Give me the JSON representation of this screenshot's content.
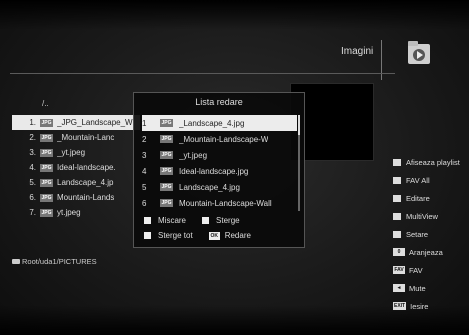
{
  "header": {
    "title": "Imagini"
  },
  "filelist": {
    "parent": "/..",
    "items": [
      {
        "num": "1.",
        "name": "_JPG_Landscape_W"
      },
      {
        "num": "2.",
        "name": "_Mountain-Lanc"
      },
      {
        "num": "3.",
        "name": "_yt.jpeg"
      },
      {
        "num": "4.",
        "name": "Ideal-landscape."
      },
      {
        "num": "5.",
        "name": "Landscape_4.jp"
      },
      {
        "num": "6.",
        "name": "Mountain-Lands"
      },
      {
        "num": "7.",
        "name": "yt.jpeg"
      }
    ],
    "badge": "JPG"
  },
  "path": "Root/uda1/PICTURES",
  "playlist": {
    "title": "Lista redare",
    "items": [
      {
        "num": "1",
        "name": "_Landscape_4.jpg"
      },
      {
        "num": "2",
        "name": "_Mountain-Landscape-W"
      },
      {
        "num": "3",
        "name": "_yt.jpeg"
      },
      {
        "num": "4",
        "name": "Ideal-landscape.jpg"
      },
      {
        "num": "5",
        "name": "Landscape_4.jpg"
      },
      {
        "num": "6",
        "name": "Mountain-Landscape-Wall"
      }
    ],
    "badge": "JPG",
    "actions": {
      "move": "Miscare",
      "delete": "Sterge",
      "delete_all": "Sterge tot",
      "ok_badge": "OK",
      "play": "Redare"
    }
  },
  "sidebar": {
    "items": [
      {
        "label": "Afiseaza playlist"
      },
      {
        "label": "FAV All"
      },
      {
        "label": "Editare"
      },
      {
        "label": "MultiView"
      },
      {
        "label": "Setare"
      },
      {
        "badge": "0",
        "label": "Aranjeaza"
      },
      {
        "badge": "FAV",
        "label": "FAV"
      },
      {
        "badge": "◄",
        "label": "Mute"
      },
      {
        "badge": "EXIT",
        "label": "Iesire"
      }
    ]
  }
}
